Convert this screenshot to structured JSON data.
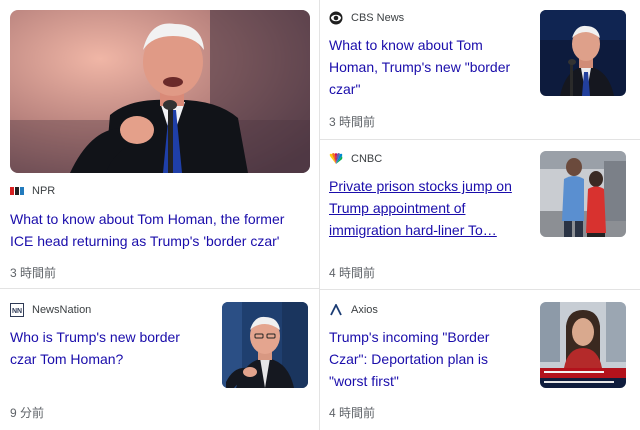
{
  "left_column": {
    "hero": {
      "source": "NPR",
      "headline": "What to know about Tom Homan, the former ICE head returning as Trump's 'border czar'",
      "time": "3 時間前"
    },
    "second": {
      "source": "NewsNation",
      "headline": "Who is Trump's new border czar Tom Homan?",
      "time": "9 分前"
    }
  },
  "right_column": {
    "items": [
      {
        "source": "CBS News",
        "headline": "What to know about Tom Homan, Trump's new \"border czar\"",
        "time": "3 時間前"
      },
      {
        "source": "CNBC",
        "headline": "Private prison stocks jump on Trump appointment of immigration hard-liner To…",
        "time": "4 時間前"
      },
      {
        "source": "Axios",
        "headline": "Trump's incoming \"Border Czar\": Deportation plan is \"worst first\"",
        "time": "4 時間前"
      }
    ]
  },
  "icons": {
    "npr": "npr-logo-icon",
    "newsnation": "newsnation-logo-icon",
    "cbs": "cbs-eye-logo-icon",
    "cnbc": "cnbc-peacock-logo-icon",
    "axios": "axios-logo-icon"
  },
  "colors": {
    "link": "#1a0dab",
    "meta": "#5f6368",
    "divider": "#e3e3e3"
  }
}
